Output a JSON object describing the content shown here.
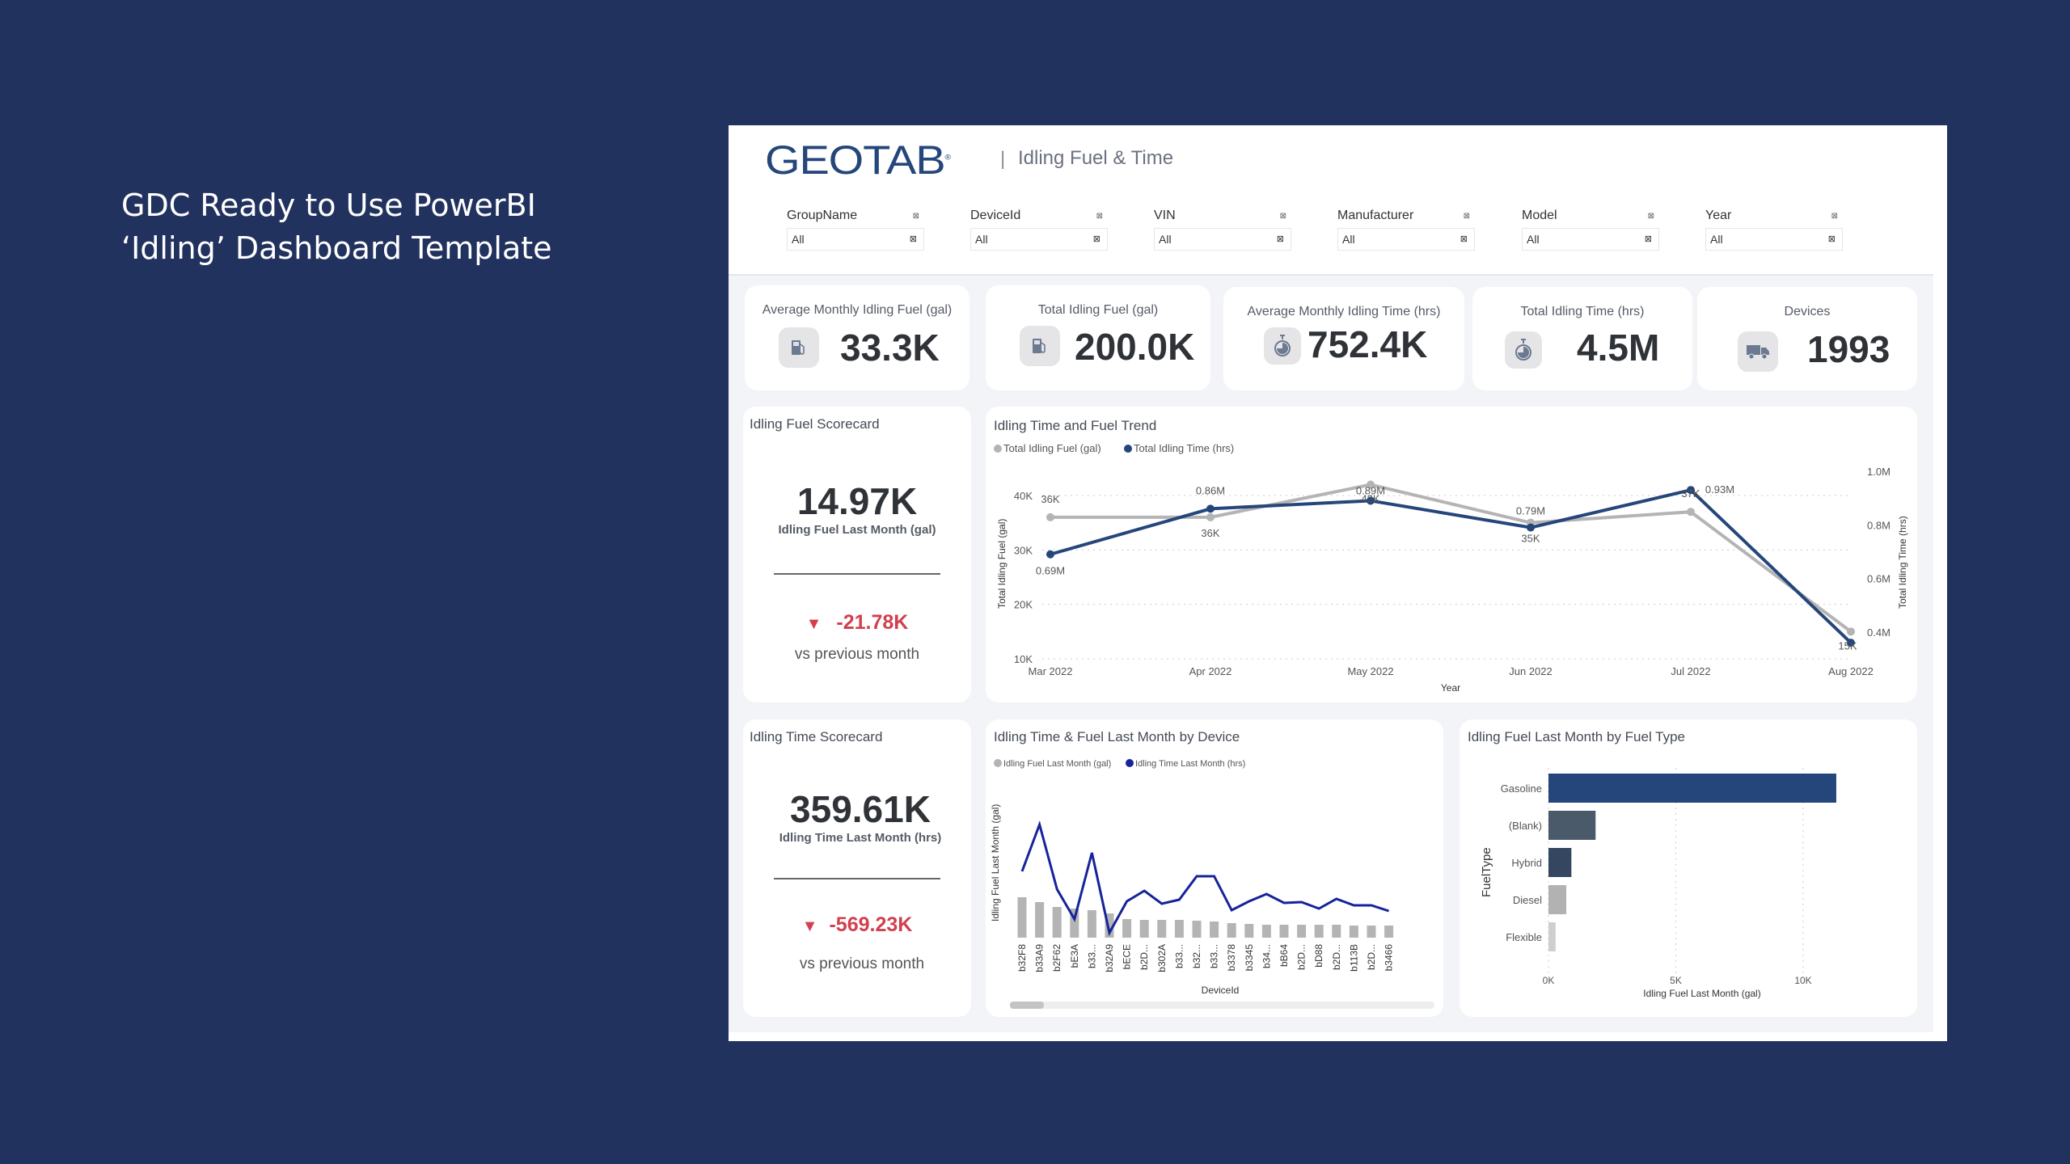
{
  "headline": {
    "line1": "GDC Ready to Use PowerBI",
    "line2": "‘Idling’ Dashboard Template"
  },
  "header": {
    "logo": "GEOTAB",
    "logo_mark": "®",
    "separator": "|",
    "title": "Idling Fuel & Time"
  },
  "slicers": [
    {
      "label": "GroupName",
      "value": "All"
    },
    {
      "label": "DeviceId",
      "value": "All"
    },
    {
      "label": "VIN",
      "value": "All"
    },
    {
      "label": "Manufacturer",
      "value": "All"
    },
    {
      "label": "Model",
      "value": "All"
    },
    {
      "label": "Year",
      "value": "All"
    }
  ],
  "slicer_icons": {
    "clear": "⊠",
    "dropdown": "⊠"
  },
  "kpis": [
    {
      "title": "Average Monthly Idling Fuel (gal)",
      "value": "33.3K",
      "icon": "fuel-pump-icon"
    },
    {
      "title": "Total Idling Fuel (gal)",
      "value": "200.0K",
      "icon": "fuel-pump-icon"
    },
    {
      "title": "Average Monthly Idling Time (hrs)",
      "value": "752.4K",
      "icon": "stopwatch-icon"
    },
    {
      "title": "Total Idling Time (hrs)",
      "value": "4.5M",
      "icon": "stopwatch-icon"
    },
    {
      "title": "Devices",
      "value": "1993",
      "icon": "truck-icon"
    }
  ],
  "scorecards": [
    {
      "title": "Idling Fuel Scorecard",
      "value": "14.97K",
      "label": "Idling Fuel Last Month (gal)",
      "delta": "-21.78K",
      "delta_icon": "▼",
      "vs": "vs previous month"
    },
    {
      "title": "Idling Time Scorecard",
      "value": "359.61K",
      "label": "Idling Time Last Month (hrs)",
      "delta": "-569.23K",
      "delta_icon": "▼",
      "vs": "vs previous month"
    }
  ],
  "colors": {
    "fuel": "#b4b4b4",
    "time": "#25467a",
    "device_time": "#16239a",
    "negative": "#d1404e"
  },
  "chart_data": [
    {
      "type": "line",
      "title": "Idling Time and Fuel Trend",
      "x": [
        "Mar 2022",
        "Apr 2022",
        "May 2022",
        "Jun 2022",
        "Jul 2022",
        "Aug 2022"
      ],
      "xlabel": "Year",
      "ylabel": "Total Idling Fuel (gal)",
      "y2label": "Total Idling Time (hrs)",
      "ylim": [
        10000,
        44000
      ],
      "y2lim": [
        300000,
        1000000
      ],
      "yticks": [
        "10K",
        "20K",
        "30K",
        "40K"
      ],
      "y2ticks": [
        "0.4M",
        "0.6M",
        "0.8M",
        "1.0M"
      ],
      "legend": "top-left",
      "grid": true,
      "series": [
        {
          "name": "Total Idling Fuel (gal)",
          "axis": "left",
          "values": [
            36000,
            36000,
            42000,
            35000,
            37000,
            15000
          ],
          "labels": [
            "36K",
            "36K",
            "42K",
            "35K",
            "37K",
            "15K"
          ]
        },
        {
          "name": "Total Idling Time (hrs)",
          "axis": "right",
          "values": [
            690000,
            860000,
            890000,
            790000,
            930000,
            360000
          ],
          "labels": [
            "0.69M",
            "0.86M",
            "0.89M",
            "0.79M",
            "0.93M",
            ""
          ]
        }
      ]
    },
    {
      "type": "bar",
      "title": "Idling Time & Fuel Last Month by Device",
      "categories": [
        "b32F8",
        "b33A9",
        "b2F62",
        "bE3A",
        "b33...",
        "b32A9",
        "bECE",
        "b2D...",
        "b302A",
        "b33...",
        "b32...",
        "b33...",
        "b3378",
        "b3345",
        "b34...",
        "bB64",
        "b2D...",
        "bD88",
        "b2D...",
        "b113B",
        "b2D...",
        "b3466"
      ],
      "xlabel": "DeviceId",
      "ylabel": "Idling Fuel Last Month (gal)",
      "legend": "top-left",
      "series": [
        {
          "name": "Idling Fuel Last Month (gal)",
          "kind": "bar",
          "values": [
            50,
            44,
            38,
            36,
            34,
            30,
            23,
            22,
            22,
            22,
            21,
            20,
            18,
            17,
            16,
            16,
            16,
            16,
            16,
            15,
            15,
            15
          ]
        },
        {
          "name": "Idling Time Last Month (hrs)",
          "kind": "line",
          "values": [
            82,
            140,
            60,
            23,
            105,
            6,
            45,
            58,
            42,
            47,
            76,
            76,
            34,
            45,
            54,
            43,
            44,
            36,
            48,
            40,
            40,
            33
          ]
        }
      ]
    },
    {
      "type": "bar",
      "orientation": "horizontal",
      "title": "Idling Fuel Last Month by Fuel Type",
      "categories": [
        "Gasoline",
        "(Blank)",
        "Hybrid",
        "Diesel",
        "Flexible"
      ],
      "values": [
        11300,
        1850,
        900,
        700,
        280
      ],
      "bar_colors": [
        "#25467a",
        "#4a5a6b",
        "#344660",
        "#b2b2b2",
        "#cfcfcf"
      ],
      "xlabel": "Idling Fuel Last Month (gal)",
      "ylabel": "FuelType",
      "xticks": [
        "0K",
        "5K",
        "10K"
      ],
      "xlim": [
        0,
        12000
      ],
      "grid": true
    }
  ]
}
